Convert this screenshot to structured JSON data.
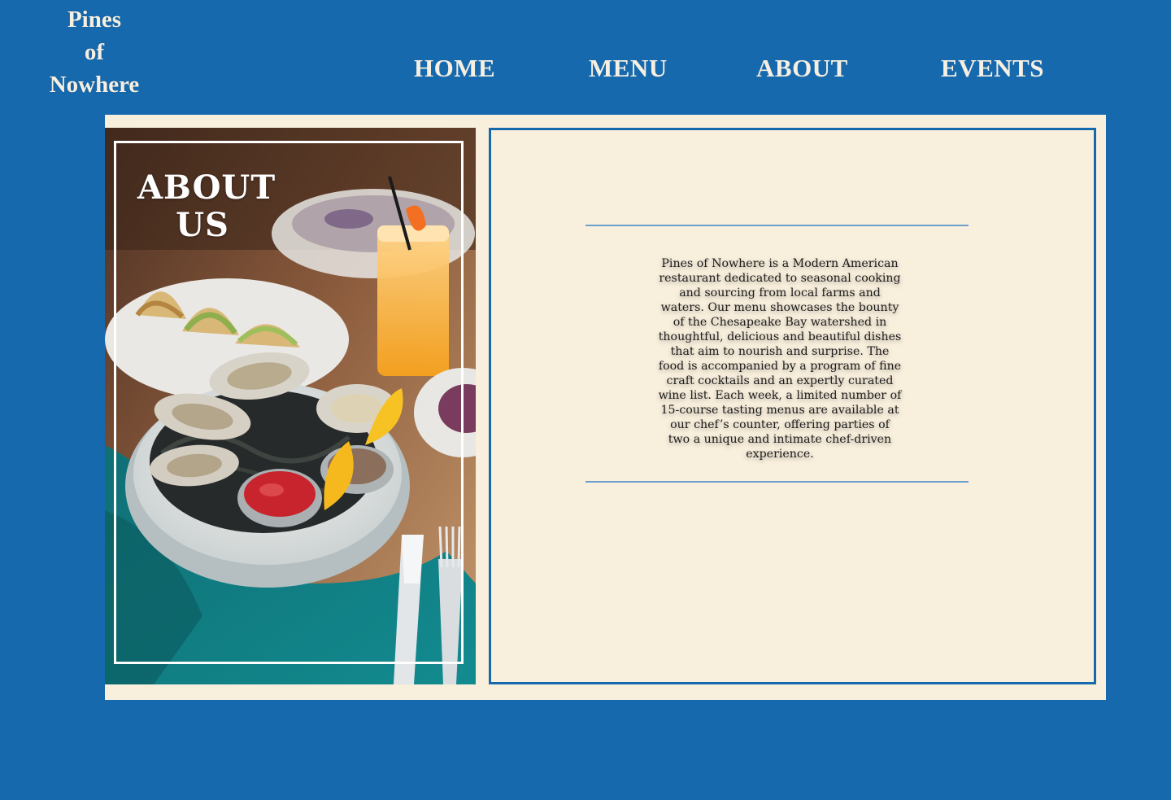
{
  "brand": {
    "name_lines": [
      "Pines",
      "of",
      "Nowhere"
    ]
  },
  "nav": {
    "items": [
      "HOME",
      "MENU",
      "ABOUT",
      "EVENTS"
    ]
  },
  "about": {
    "title_lines": [
      "ABOUT",
      "US"
    ],
    "body": "Pines of Nowhere is a Modern American restaurant dedicated to seasonal cooking and sourcing from local farms and waters. Our menu showcases the bounty of the Chesapeake Bay watershed in thoughtful, delicious and beautiful dishes that aim to nourish and surprise. The food is accompanied by a program of fine craft cocktails and an expertly curated wine list. Each week, a limited number of 15-course tasting menus are available at our chef’s counter, offering parties of two a unique and intimate chef-driven experience."
  },
  "colors": {
    "page_background": "#1769ad",
    "panel_background": "#f9efdd",
    "accent_blue": "#1769ad",
    "rule_blue": "#6d9fcd",
    "header_text": "#f6efe2"
  }
}
